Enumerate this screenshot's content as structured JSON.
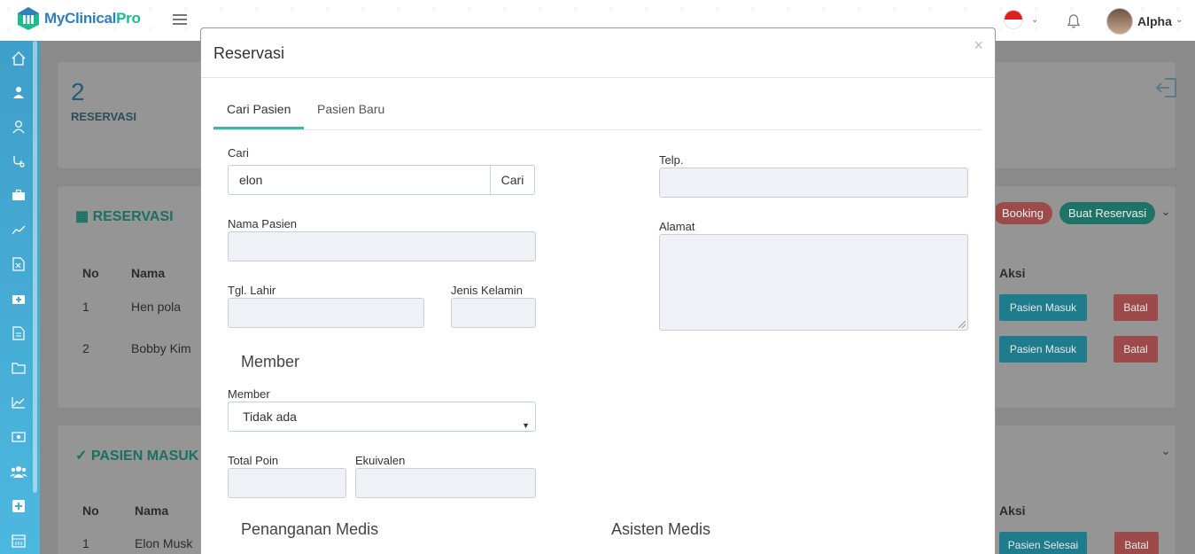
{
  "app": {
    "brand_main": "MyClinical",
    "brand_accent": "Pro",
    "user_name": "Alpha",
    "colors": {
      "accent_teal": "#38b7a8",
      "sidebar_blue": "#3e9fc9",
      "brand_blue": "#2f7fbf",
      "brand_green": "#1fb98f",
      "danger": "#d9534f"
    }
  },
  "sidebar": {
    "icons": [
      "home-icon",
      "doctor-icon",
      "user-icon",
      "stethoscope-icon",
      "briefcase-icon",
      "chart-line-icon",
      "excel-file-icon",
      "medkit-icon",
      "document-icon",
      "folder-icon",
      "area-chart-icon",
      "money-icon",
      "users-icon",
      "plus-square-icon",
      "calendar-icon"
    ],
    "active": "users-icon"
  },
  "background": {
    "stat_count": "2",
    "stat_label": "RESERVASI",
    "reservasi_title": "RESERVASI",
    "booking_button": "Booking",
    "buat_reservasi_button": "Buat Reservasi",
    "table1": {
      "headers": [
        "No",
        "Nama",
        "Aksi"
      ],
      "rows": [
        {
          "no": "1",
          "nama": "Hen pola",
          "action": "Pasien Masuk",
          "cancel": "Batal"
        },
        {
          "no": "2",
          "nama": "Bobby Kim",
          "action": "Pasien Masuk",
          "cancel": "Batal"
        }
      ]
    },
    "pasien_masuk_title": "PASIEN MASUK",
    "table2": {
      "headers": [
        "No",
        "Nama",
        "Aksi"
      ],
      "rows": [
        {
          "no": "1",
          "nama": "Elon Musk",
          "action": "Pasien Selesai",
          "cancel": "Batal"
        }
      ]
    }
  },
  "modal": {
    "title": "Reservasi",
    "close": "×",
    "tabs": [
      {
        "label": "Cari Pasien",
        "active": true
      },
      {
        "label": "Pasien Baru",
        "active": false
      }
    ],
    "search": {
      "label": "Cari",
      "value": "elon",
      "button": "Cari"
    },
    "nama_pasien_label": "Nama Pasien",
    "tgl_lahir_label": "Tgl. Lahir",
    "jenis_kelamin_label": "Jenis Kelamin",
    "telp_label": "Telp.",
    "alamat_label": "Alamat",
    "member_section": "Member",
    "member_label": "Member",
    "member_selected": "Tidak ada",
    "total_poin_label": "Total Poin",
    "ekuivalen_label": "Ekuivalen",
    "penanganan_section": "Penanganan Medis",
    "asisten_section": "Asisten Medis"
  }
}
